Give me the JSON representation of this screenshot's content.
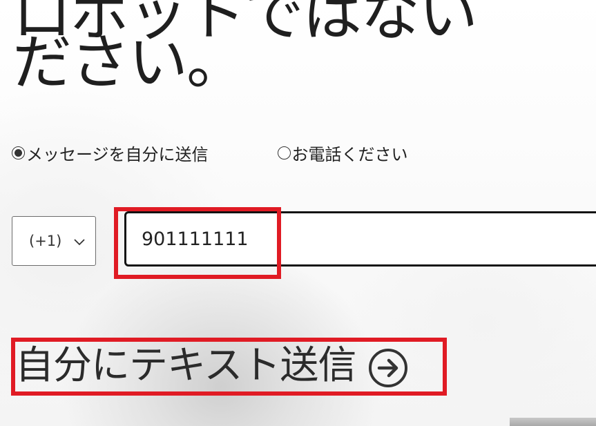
{
  "heading": {
    "text": "ロボットではない\nださい。"
  },
  "contact_method": {
    "options": [
      {
        "label": "メッセージを自分に送信",
        "selected": true
      },
      {
        "label": "お電話ください",
        "selected": false
      }
    ]
  },
  "phone": {
    "country_code": "(+1)",
    "number": "901111111"
  },
  "send": {
    "label": "自分にテキスト送信"
  },
  "icons": {
    "select_chevron": "chevron-down-icon",
    "send_arrow": "arrow-right-circle-icon"
  },
  "colors": {
    "highlight": "#e01b24",
    "text": "#222222"
  }
}
